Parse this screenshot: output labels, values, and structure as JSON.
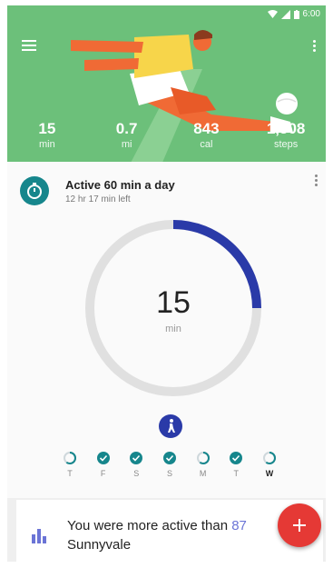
{
  "status_bar": {
    "time": "6:00"
  },
  "header": {
    "background_color": "#6cc07a",
    "stats": [
      {
        "value": "15",
        "unit": "min"
      },
      {
        "value": "0.7",
        "unit": "mi"
      },
      {
        "value": "843",
        "unit": "cal"
      },
      {
        "value": "1,508",
        "unit": "steps"
      }
    ]
  },
  "goal": {
    "title": "Active 60 min a day",
    "subtitle": "12 hr 17 min left",
    "value": "15",
    "unit": "min",
    "progress_fraction": 0.25,
    "progress_color": "#2a3aa8"
  },
  "week": {
    "days": [
      {
        "label": "T",
        "status": "partial"
      },
      {
        "label": "F",
        "status": "complete"
      },
      {
        "label": "S",
        "status": "complete"
      },
      {
        "label": "S",
        "status": "complete"
      },
      {
        "label": "M",
        "status": "partial"
      },
      {
        "label": "T",
        "status": "complete"
      },
      {
        "label": "W",
        "status": "partial",
        "today": true
      }
    ]
  },
  "insight": {
    "text_before": "You were more active than ",
    "highlight": "87",
    "line2": "Sunnyvale"
  },
  "fab": {
    "icon": "plus-icon",
    "color": "#e53935"
  }
}
